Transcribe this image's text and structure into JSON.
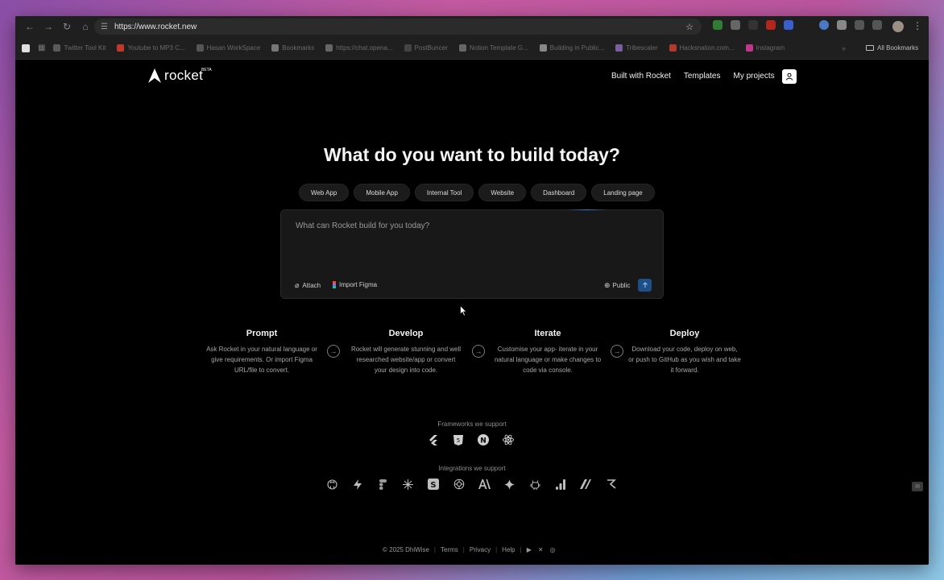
{
  "browser": {
    "url": "https://www.rocket.new",
    "bookmarks": [
      {
        "label": "Twitter Tool Kit",
        "color": "#5a5a5a"
      },
      {
        "label": "Youtube to MP3 C...",
        "color": "#c0392b"
      },
      {
        "label": "Hasan WorkSpace",
        "color": "#555555"
      },
      {
        "label": "Bookmarks",
        "color": "#777777"
      },
      {
        "label": "https://chat.opena...",
        "color": "#666666"
      },
      {
        "label": "PostBuncer",
        "color": "#444444"
      },
      {
        "label": "Notion Template G...",
        "color": "#666666"
      },
      {
        "label": "Building in Public...",
        "color": "#888888"
      },
      {
        "label": "Tribescaler",
        "color": "#7a5fa0"
      },
      {
        "label": "Hacksnation.com...",
        "color": "#b03a2e"
      },
      {
        "label": "Instagram",
        "color": "#c1358a"
      }
    ],
    "all_bookmarks": "All Bookmarks"
  },
  "brand": {
    "name": "rocket",
    "badge": "BETA"
  },
  "nav": {
    "built_with": "Built with Rocket",
    "templates": "Templates",
    "my_projects": "My projects"
  },
  "hero": {
    "title": "What do you want to build today?"
  },
  "chips": [
    "Web App",
    "Mobile App",
    "Internal Tool",
    "Website",
    "Dashboard",
    "Landing page"
  ],
  "prompt": {
    "placeholder": "What can Rocket build for you today?",
    "attach": "Attach",
    "import_figma": "Import Figma",
    "visibility": "Public"
  },
  "steps": [
    {
      "title": "Prompt",
      "desc": "Ask Rocket in your natural language or give requirements. Or import Figma URL/file to convert."
    },
    {
      "title": "Develop",
      "desc": "Rocket will generate stunning and well researched website/app or convert your design into code."
    },
    {
      "title": "Iterate",
      "desc": "Customise your app- iterate in your natural language or make changes to code via console."
    },
    {
      "title": "Deploy",
      "desc": "Download your code, deploy on web, or push to GitHub as you wish and take it forward."
    }
  ],
  "frameworks": {
    "label": "Frameworks we support",
    "icons": [
      "flutter-icon",
      "html5-icon",
      "nextjs-icon",
      "react-icon"
    ]
  },
  "integrations": {
    "label": "Integrations we support",
    "icons": [
      "github-icon",
      "supabase-icon",
      "figma-icon",
      "perplexity-icon",
      "shopify-icon",
      "openai-icon",
      "anthropic-icon",
      "gemini-icon",
      "android-icon",
      "analytics-icon",
      "mailchimp-icon",
      "resend-icon"
    ]
  },
  "footer": {
    "copyright": "© 2025 DhiWise",
    "terms": "Terms",
    "privacy": "Privacy",
    "help": "Help"
  },
  "colors": {
    "accent": "#1e4f86",
    "background": "#000000",
    "surface": "#181818"
  }
}
